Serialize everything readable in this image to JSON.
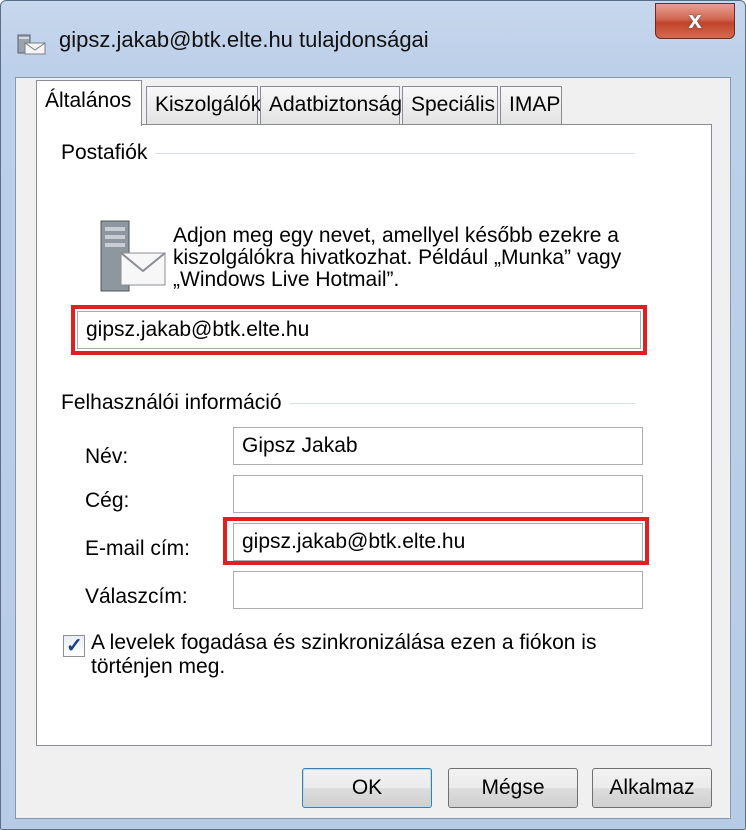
{
  "window": {
    "title": "gipsz.jakab@btk.elte.hu tulajdonságai",
    "close_label": "x"
  },
  "tabs": [
    {
      "label": "Általános",
      "active": true
    },
    {
      "label": "Kiszolgálók",
      "active": false
    },
    {
      "label": "Adatbiztonság",
      "active": false
    },
    {
      "label": "Speciális",
      "active": false
    },
    {
      "label": "IMAP",
      "active": false
    }
  ],
  "account": {
    "group_label": "Postafiók",
    "info": "Adjon meg egy nevet, amellyel később ezekre a kiszolgálókra hivatkozhat. Például „Munka” vagy „Windows Live Hotmail”.",
    "name_value": "gipsz.jakab@btk.elte.hu"
  },
  "user": {
    "group_label": "Felhasználói információ",
    "name_label": "Név:",
    "name_value": "Gipsz Jakab",
    "company_label": "Cég:",
    "company_value": "",
    "email_label": "E-mail cím:",
    "email_value": "gipsz.jakab@btk.elte.hu",
    "reply_label": "Válaszcím:",
    "reply_value": ""
  },
  "sync": {
    "checked": true,
    "label": "A levelek fogadása és szinkronizálása ezen a fiókon is történjen meg."
  },
  "buttons": {
    "ok": "OK",
    "cancel": "Mégse",
    "apply": "Alkalmaz"
  },
  "colors": {
    "highlight": "#e02020",
    "title_bg": "#bdd0ea",
    "close_bg": "#c0442b"
  }
}
